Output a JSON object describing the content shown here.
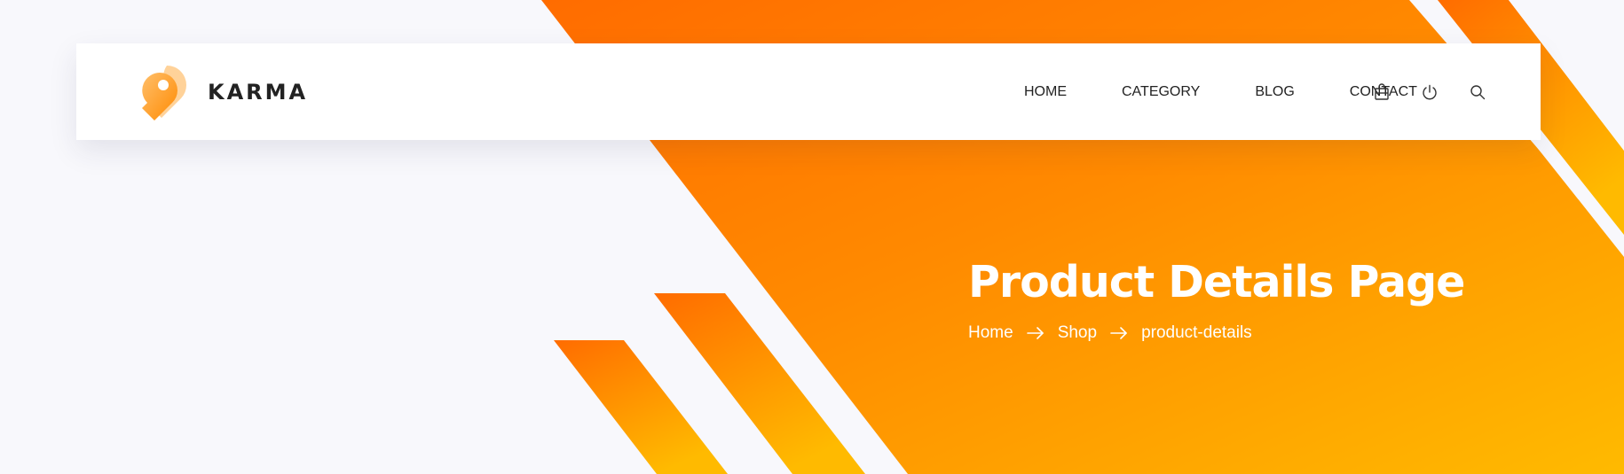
{
  "header": {
    "brand": "KARMA",
    "logo_icon": "map-pin-logo-icon",
    "nav": [
      {
        "label": "HOME"
      },
      {
        "label": "CATEGORY"
      },
      {
        "label": "BLOG"
      },
      {
        "label": "CONTACT"
      }
    ],
    "icons": [
      "shopping-bag-icon",
      "power-icon",
      "search-icon"
    ]
  },
  "banner": {
    "title": "Product Details Page",
    "breadcrumb": [
      "Home",
      "Shop",
      "product-details"
    ],
    "breadcrumb_separator_icon": "arrow-right-icon"
  },
  "colors": {
    "gradient_start": "#ff6c00",
    "gradient_end": "#ffba00",
    "page_background": "#f8f8fc",
    "header_background": "#ffffff",
    "text_dark": "#222222",
    "text_light": "#ffffff"
  }
}
